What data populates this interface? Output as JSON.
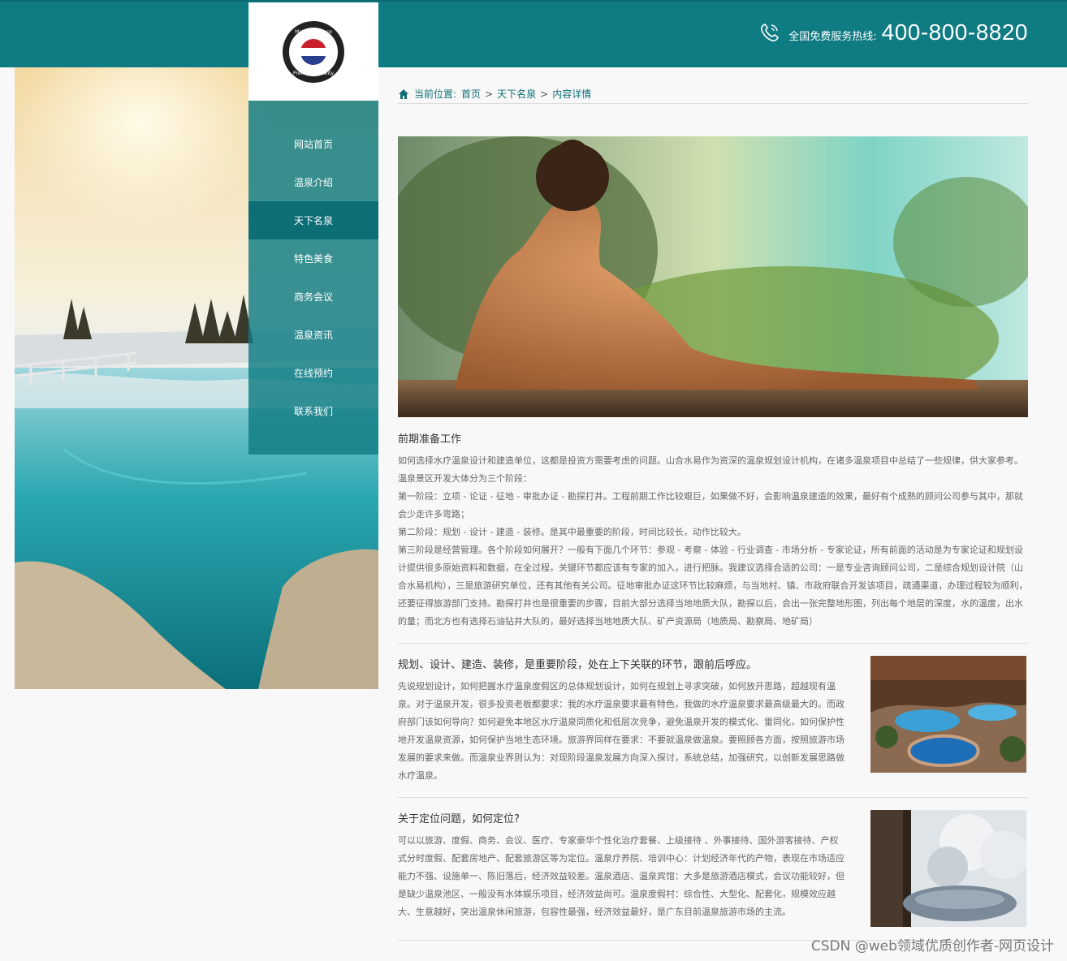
{
  "header": {
    "hotline_label": "全国免费服务热线:",
    "hotline_number": "400-800-8820",
    "logo_text_top": "Made In France",
    "logo_text_bottom": "Premium Quality"
  },
  "nav": {
    "items": [
      {
        "label": "网站首页"
      },
      {
        "label": "温泉介绍"
      },
      {
        "label": "天下名泉",
        "active": true
      },
      {
        "label": "特色美食"
      },
      {
        "label": "商务会议"
      },
      {
        "label": "温泉资讯"
      },
      {
        "label": "在线预约"
      },
      {
        "label": "联系我们"
      }
    ]
  },
  "breadcrumb": {
    "prefix": "当前位置:",
    "home": "首页",
    "sep": ">",
    "section": "天下名泉",
    "current": "内容详情"
  },
  "article": {
    "sec1": {
      "title": "前期准备工作",
      "paras": [
        "如何选择水疗温泉设计和建造单位，这都是投资方需要考虑的问题。山合水易作为资深的温泉规划设计机构，在诸多温泉项目中总结了一些规律，供大家参考。温泉景区开发大体分为三个阶段：",
        "第一阶段：立项 - 论证 - 征地 - 审批办证 - 勘探打井。工程前期工作比较艰巨，如果做不好，会影响温泉建造的效果，最好有个成熟的顾问公司参与其中，那就会少走许多弯路；",
        "第二阶段：规划 - 设计 - 建造 - 装修。是其中最重要的阶段，时间比较长，动作比较大。",
        "第三阶段是经营管理。各个阶段如何展开？一般有下面几个环节：参观 - 考察 - 体验 - 行业调查 - 市场分析 - 专家论证，所有前面的活动是为专家论证和规划设计提供很多原始资料和数据，在全过程，关键环节都应该有专家的加入，进行把脉。我建议选择合适的公司：一是专业咨询顾问公司，二是综合规划设计院（山合水易机构），三是旅游研究单位，还有其他有关公司。征地审批办证这环节比较麻烦，与当地村、镇、市政府联合开发该项目，疏通渠道，办理过程较为顺利，还要征得旅游部门支持。勘探打井也是很重要的步骤，目前大部分选择当地地质大队，勘探以后，会出一张完整地形图，列出每个地层的深度，水的温度，出水的量；而北方也有选择石油钻井大队的，最好选择当地地质大队、矿产资源局（地质局、勘察局、地矿局）"
      ]
    },
    "sec2": {
      "title": "规划、设计、建造、装修，是重要阶段，处在上下关联的环节，跟前后呼应。",
      "text": "先说规划设计，如何把握水疗温泉度假区的总体规划设计，如何在规划上寻求突破，如何放开思路，超越现有温泉。对于温泉开发，很多投资老板都要求：我的水疗温泉要求最有特色，我做的水疗温泉要求最高级最大的。而政府部门该如何导向？如何避免本地区水疗温泉同质化和低层次竞争，避免温泉开发的模式化、雷同化，如何保护性地开发温泉资源，如何保护当地生态环境。旅游界同样在要求：不要就温泉做温泉。要照顾各方面，按照旅游市场发展的要求来做。而温泉业界则认为：对现阶段温泉发展方向深入探讨，系统总结，加强研究，以创新发展思路做水疗温泉。"
    },
    "sec3": {
      "title": "关于定位问题，如何定位?",
      "text": "可以以旅游、度假、商务、会议、医疗、专家豪华个性化治疗套餐、上级接待 、外事接待、国外游客接待、产权式分时度假、配套房地产、配套旅游区等为定位。温泉疗养院、培训中心：计划经济年代的产物，表现在市场适应能力不强、设施单一、陈旧落后，经济效益较差。温泉酒店、温泉宾馆：大多是旅游酒店模式，会议功能较好，但是缺少温泉池区、一般没有水体娱乐项目，经济效益尚可。温泉度假村：综合性、大型化、配套化，规模效应越大、生意越好，突出温泉休闲旅游，包容性最强，经济效益最好，是广东目前温泉旅游市场的主流。"
    }
  },
  "watermark": "CSDN @web领域优质创作者-网页设计",
  "colors": {
    "brand": "#0f7b82",
    "nav_active": "#0d6e75"
  }
}
